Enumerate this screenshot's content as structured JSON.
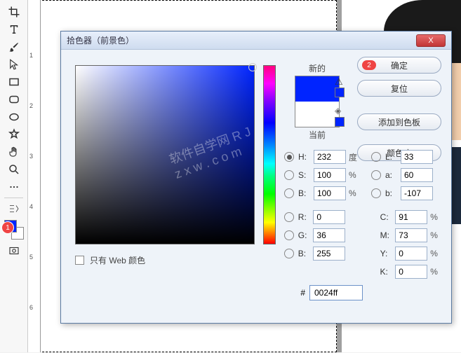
{
  "ruler_v": [
    "",
    "1",
    "2",
    "3",
    "4",
    "5",
    "6"
  ],
  "badge1": "1",
  "dialog": {
    "title": "拾色器（前景色）",
    "close": "X",
    "buttons": {
      "ok": "确定",
      "ok_badge": "2",
      "reset": "复位",
      "add_swatch": "添加到色板",
      "libraries": "颜色库"
    },
    "preview": {
      "new_label": "新的",
      "current_label": "当前"
    },
    "fields": {
      "H": {
        "label": "H:",
        "value": "232",
        "unit": "度"
      },
      "S": {
        "label": "S:",
        "value": "100",
        "unit": "%"
      },
      "BV": {
        "label": "B:",
        "value": "100",
        "unit": "%"
      },
      "L": {
        "label": "L:",
        "value": "33"
      },
      "a": {
        "label": "a:",
        "value": "60"
      },
      "b": {
        "label": "b:",
        "value": "-107"
      },
      "R": {
        "label": "R:",
        "value": "0"
      },
      "G": {
        "label": "G:",
        "value": "36"
      },
      "Bch": {
        "label": "B:",
        "value": "255"
      },
      "C": {
        "label": "C:",
        "value": "91",
        "unit": "%"
      },
      "M": {
        "label": "M:",
        "value": "73",
        "unit": "%"
      },
      "Y": {
        "label": "Y:",
        "value": "0",
        "unit": "%"
      },
      "K": {
        "label": "K:",
        "value": "0",
        "unit": "%"
      },
      "hex": {
        "label": "#",
        "value": "0024ff"
      }
    },
    "web_only": "只有 Web 颜色",
    "watermark": "软件自学网\nR J z x w . c o m"
  }
}
